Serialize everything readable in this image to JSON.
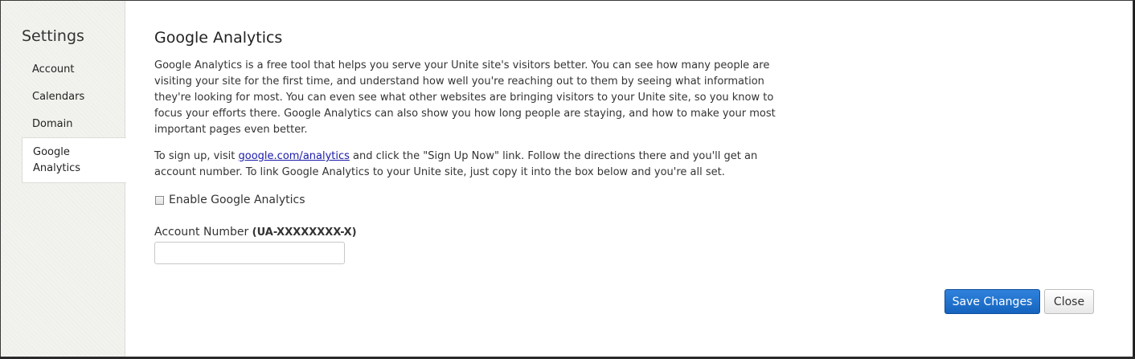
{
  "sidebar": {
    "title": "Settings",
    "items": [
      {
        "label": "Account"
      },
      {
        "label": "Calendars"
      },
      {
        "label": "Domain"
      },
      {
        "label": "Google Analytics",
        "active": true
      }
    ]
  },
  "main": {
    "title": "Google Analytics",
    "intro": "Google Analytics is a free tool that helps you serve your Unite site's visitors better. You can see how many people are visiting your site for the first time, and understand how well you're reaching out to them by seeing what information they're looking for most. You can even see what other websites are bringing visitors to your Unite site, so you know to focus your efforts there. Google Analytics can also show you how long people are staying, and how to make your most important pages even better.",
    "signup_before": "To sign up, visit ",
    "signup_link": "google.com/analytics",
    "signup_after": " and click the \"Sign Up Now\" link. Follow the directions there and you'll get an account number. To link Google Analytics to your Unite site, just copy it into the box below and you're all set.",
    "enable_label": "Enable Google Analytics",
    "enable_checked": false,
    "account_label": "Account Number ",
    "account_format": "(UA-XXXXXXXX-X)",
    "account_value": "",
    "account_placeholder": ""
  },
  "buttons": {
    "save_label": "Save Changes",
    "close_label": "Close"
  },
  "colors": {
    "primary": "#1b6fd1",
    "link": "#1a1aaa"
  }
}
